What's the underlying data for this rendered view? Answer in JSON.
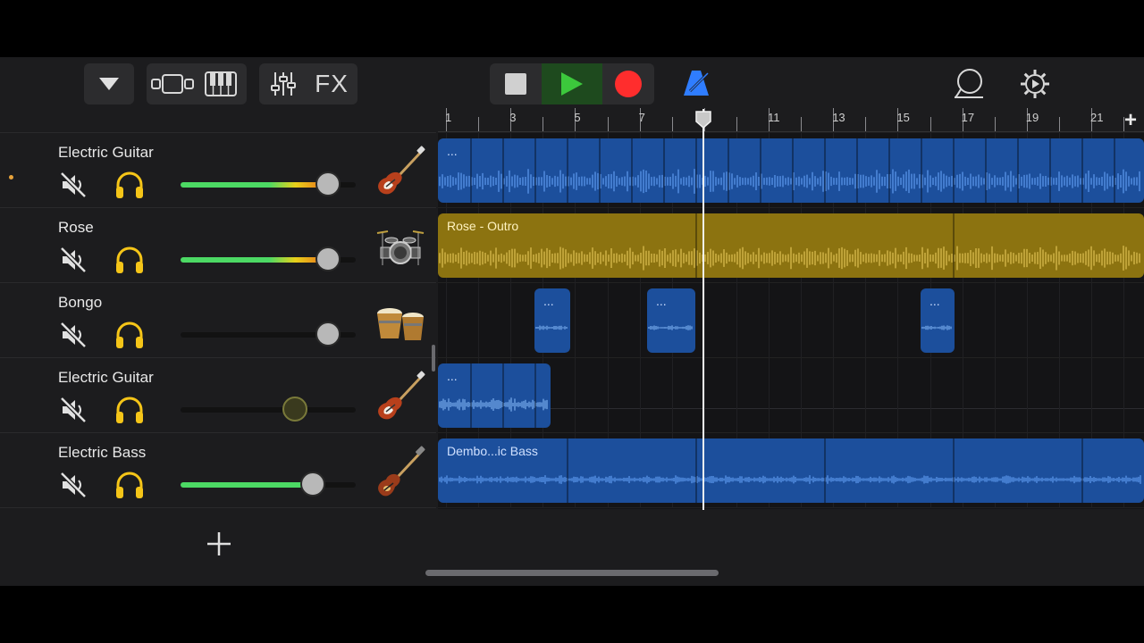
{
  "toolbar": {
    "fx_label": "FX",
    "play_color": "#3cc83c",
    "record_color": "#ff2d2d",
    "metronome_color": "#2f7dff"
  },
  "ruler": {
    "labels": [
      "1",
      "3",
      "5",
      "7",
      "9",
      "11",
      "13",
      "15",
      "17",
      "19",
      "21"
    ],
    "add_icon": "+"
  },
  "tracks": [
    {
      "name": "Electric Guitar",
      "instrument": "electric-guitar",
      "volume": 0.9,
      "level_color": "green-yellow",
      "selected": true
    },
    {
      "name": "Rose",
      "instrument": "drum-kit",
      "volume": 0.9,
      "level_color": "green-yellow",
      "selected": false
    },
    {
      "name": "Bongo",
      "instrument": "bongo",
      "volume": 0.9,
      "level_color": "none",
      "selected": false
    },
    {
      "name": "Electric Guitar",
      "instrument": "electric-guitar",
      "volume": 0.68,
      "level_color": "none",
      "selected": false
    },
    {
      "name": "Electric Bass",
      "instrument": "electric-bass",
      "volume": 0.8,
      "level_color": "green",
      "selected": false
    }
  ],
  "regions": {
    "guitar1": {
      "label": "..."
    },
    "rose": {
      "label": "Rose - Outro"
    },
    "bongo": {
      "label": "..."
    },
    "guitar2": {
      "label": "..."
    },
    "bass": {
      "label": "Dembo...ic Bass"
    }
  },
  "colors": {
    "blue_region": "#1c4f9c",
    "gold_region": "#8c7310",
    "level_green": "#4cd964",
    "level_yellow": "#f5c518"
  }
}
